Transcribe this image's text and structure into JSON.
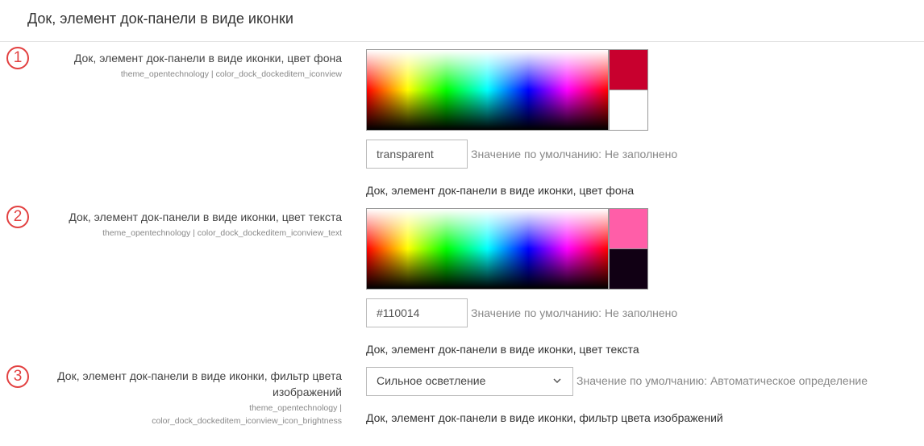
{
  "page": {
    "title": "Док, элемент док-панели в виде иконки"
  },
  "settings": [
    {
      "number": "1",
      "label": "Док, элемент док-панели в виде иконки, цвет фона",
      "key": "theme_opentechnology | color_dock_dockeditem_iconview",
      "new_color": "#c8002e",
      "old_color": "#ffffff",
      "value": "transparent",
      "default_hint": "Значение по умолчанию: Не заполнено",
      "description": "Док, элемент док-панели в виде иконки, цвет фона"
    },
    {
      "number": "2",
      "label": "Док, элемент док-панели в виде иконки, цвет текста",
      "key": "theme_opentechnology | color_dock_dockeditem_iconview_text",
      "new_color": "#ff5ea8",
      "old_color": "#110014",
      "value": "#110014",
      "default_hint": "Значение по умолчанию: Не заполнено",
      "description": "Док, элемент док-панели в виде иконки, цвет текста"
    },
    {
      "number": "3",
      "label_line1": "Док, элемент док-панели в виде иконки, фильтр цвета",
      "label_line2": "изображений",
      "key_line1": "theme_opentechnology |",
      "key_line2": "color_dock_dockeditem_iconview_icon_brightness",
      "selected": "Сильное осветление",
      "default_hint": "Значение по умолчанию: Автоматическое определение",
      "description": "Док, элемент док-панели в виде иконки, фильтр цвета изображений"
    }
  ]
}
